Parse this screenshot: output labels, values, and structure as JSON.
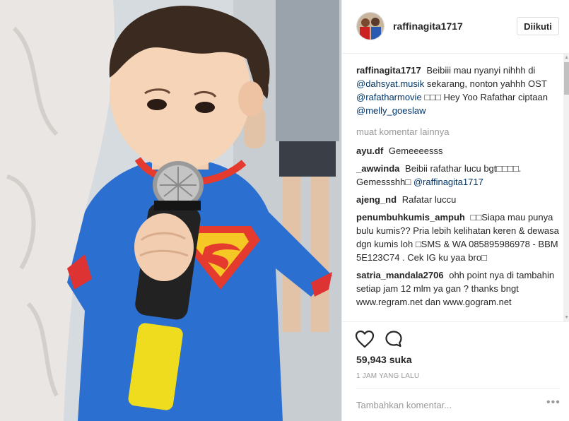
{
  "post": {
    "photo_icon": "boy-with-microphone-photo"
  },
  "header": {
    "username": "raffinagita1717",
    "follow_label": "Diikuti"
  },
  "caption": {
    "username": "raffinagita1717",
    "text1": "Beibiii mau nyanyi nihhh di",
    "mention1": "@dahsyat.musik",
    "text2": "sekarang, nonton yahhh OST",
    "mention2": "@rafatharmovie",
    "text3": "□□□ Hey Yoo Rafathar ciptaan",
    "mention3": "@melly_goeslaw"
  },
  "load_more": "muat komentar lainnya",
  "comments": [
    {
      "username": "ayu.df",
      "text": "Gemeeeesss"
    },
    {
      "username": "_awwinda",
      "text": "Beibii rafathar lucu bgt□□□□. Gemessshh□",
      "mention": "@raffinagita1717"
    },
    {
      "username": "ajeng_nd",
      "text": "Rafatar luccu"
    },
    {
      "username": "penumbuhkumis_ampuh",
      "text": "□□Siapa mau punya bulu kumis?? Pria lebih kelihatan keren & dewasa dgn kumis loh □SMS & WA 085895986978 - BBM 5E123C74 . Cek IG ku yaa bro□"
    },
    {
      "username": "satria_mandala2706",
      "text": "ohh point nya di tambahin setiap jam 12 mlm ya gan ? thanks bngt www.regram.net dan www.gogram.net"
    }
  ],
  "actions": {
    "like_icon": "heart-icon",
    "comment_icon": "comment-bubble-icon",
    "likes": "59,943 suka",
    "time": "1 JAM YANG LALU",
    "comment_placeholder": "Tambahkan komentar...",
    "options": "•••"
  }
}
